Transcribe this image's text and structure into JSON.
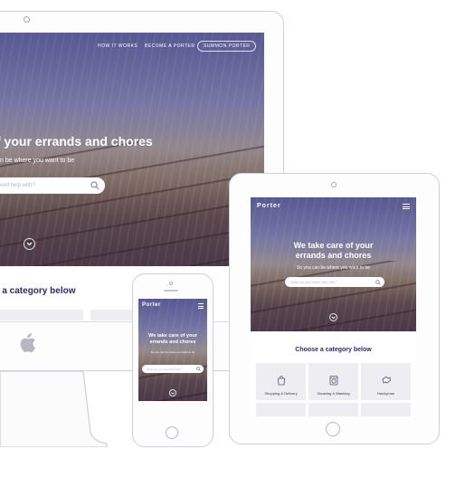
{
  "desktop": {
    "nav": {
      "links": [
        "HOW IT WORKS",
        "BECOME A PORTER"
      ],
      "cta": "SUMMON PORTER"
    },
    "hero": {
      "title": "f your errands and chores",
      "subtitle": "n be where you want to be",
      "search_placeholder": "eed help with?"
    },
    "category_heading": "e a category below"
  },
  "tablet": {
    "brand": "Porter",
    "hero": {
      "title_line1": "We take care of your",
      "title_line2": "errands and chores",
      "subtitle": "So you can be where you want to be",
      "search_placeholder": "What do you need help with?"
    },
    "category_heading": "Choose a category below",
    "categories": [
      "Shopping & Delivery",
      "Cleaning & Washing",
      "Handyman"
    ]
  },
  "phone": {
    "brand": "Porter",
    "hero": {
      "title_line1": "We take care of your",
      "title_line2": "errands and chores",
      "subtitle": "So you can be where you want to be",
      "search_placeholder": "What do you need help with?"
    }
  },
  "colors": {
    "hero_overlay": "#4a4888",
    "heading": "#2e2a66",
    "device_frame": "#fdfdfd",
    "device_outline": "#cfcfd6"
  }
}
